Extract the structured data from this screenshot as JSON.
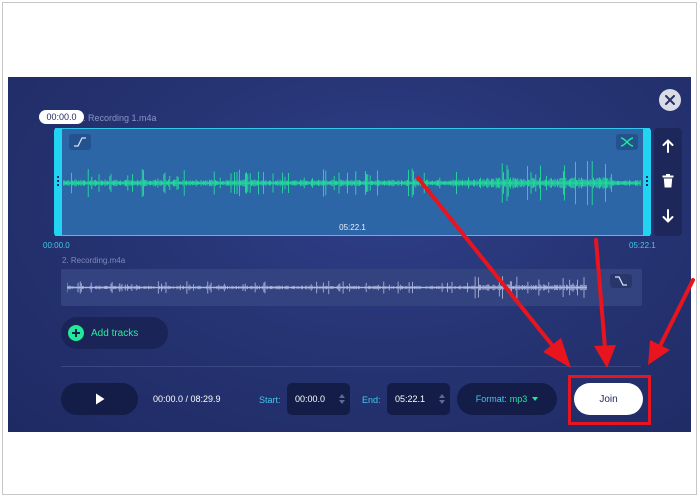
{
  "editor": {
    "track1": {
      "name": "2. Recording 1.m4a",
      "time_pill": "00:00.0",
      "duration": "05:22.1",
      "start_tick": "00:00.0",
      "end_tick": "05:22.1"
    },
    "track2": {
      "name": "2. Recording.m4a"
    },
    "add_tracks_label": "Add tracks"
  },
  "controls": {
    "time_readout": "00:00.0 / 08:29.9",
    "start_label": "Start:",
    "start_value": "00:00.0",
    "end_label": "End:",
    "end_value": "05:22.1",
    "format_label": "Format:",
    "format_value": "mp3",
    "join_label": "Join"
  },
  "colors": {
    "accent_green": "#22e89a",
    "accent_cyan": "#22d3f2",
    "annotation_red": "#e8141e",
    "panel_bg": "#263474"
  },
  "icons": [
    "close-icon",
    "fade-in-icon",
    "swap-icon",
    "arrow-up-icon",
    "trash-icon",
    "arrow-down-icon",
    "fade-out-icon",
    "plus-icon",
    "play-icon"
  ]
}
